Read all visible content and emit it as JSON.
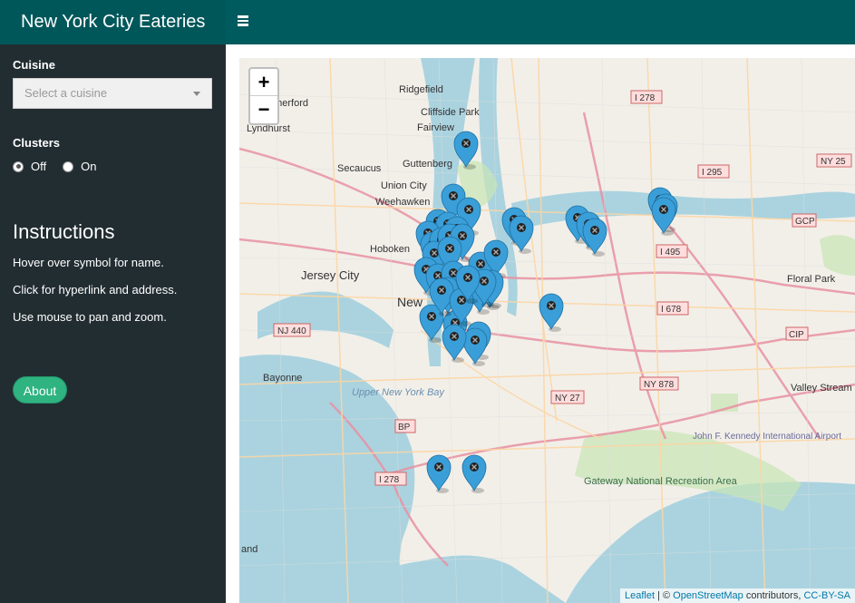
{
  "app": {
    "title": "New York City Eateries"
  },
  "sidebar": {
    "cuisine_label": "Cuisine",
    "cuisine_placeholder": "Select a cuisine",
    "clusters_label": "Clusters",
    "cluster_off": "Off",
    "cluster_on": "On",
    "cluster_selected": "Off",
    "instructions_title": "Instructions",
    "instructions": [
      "Hover over symbol for name.",
      "Click for hyperlink and address.",
      "Use mouse to pan and zoom."
    ],
    "about_label": "About"
  },
  "map": {
    "zoom_in": "+",
    "zoom_out": "−",
    "attribution": {
      "leaflet": "Leaflet",
      "sep": " | © ",
      "osm": "OpenStreetMap",
      "contributors": " contributors, ",
      "license": "CC-BY-SA"
    },
    "labels": [
      "Ridgefield",
      "Cliffside Park",
      "Fairview",
      "Rutherford",
      "Lyndhurst",
      "Secaucus",
      "Guttenberg",
      "Union City",
      "Weehawken",
      "Hoboken",
      "Jersey City",
      "New",
      "Bayonne",
      "Upper New York Bay",
      "Gateway National Recreation Area",
      "Floral Park",
      "Valley Stream",
      "John F. Kennedy International Airport",
      "and"
    ],
    "route_shields": [
      "I 278",
      "I 295",
      "NY 25",
      "GCP",
      "I 495",
      "I 678",
      "CIP",
      "NY 878",
      "NY 27",
      "NJ 440",
      "BP",
      "I 278"
    ],
    "colors": {
      "marker": "#3a9fd8",
      "marker_dark": "#1f6fa0",
      "water": "#aad3df",
      "land": "#f2efe9",
      "park": "#c8e6b4"
    }
  }
}
